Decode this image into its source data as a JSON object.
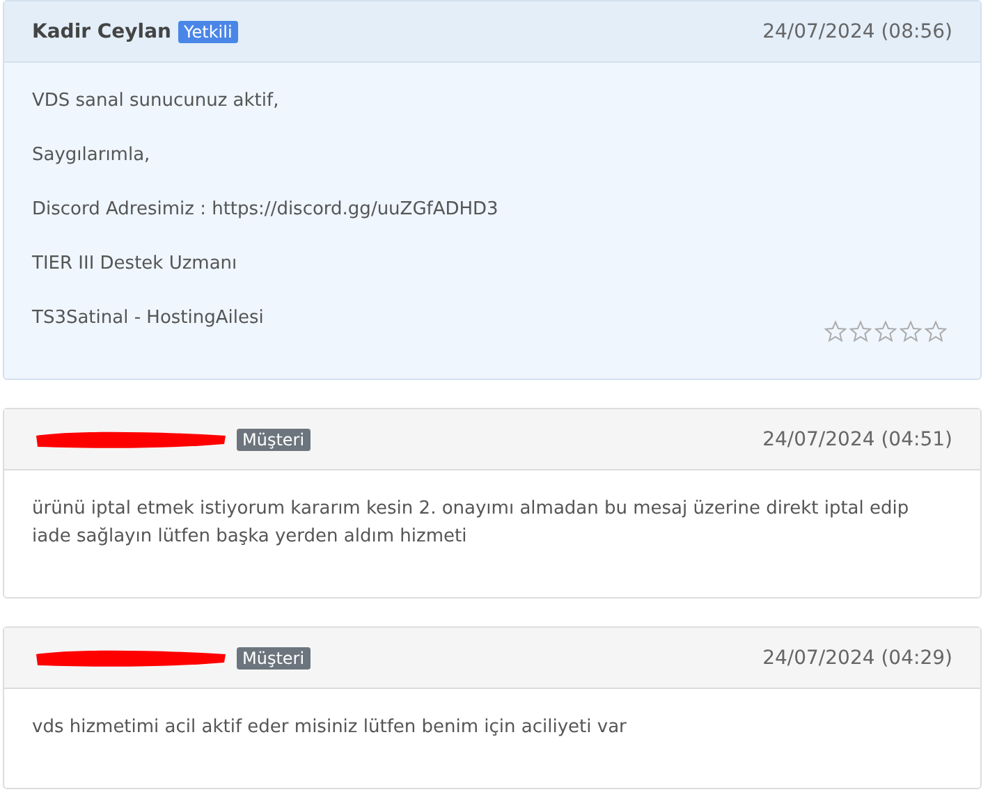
{
  "messages": [
    {
      "author": "Kadir Ceylan",
      "redacted": false,
      "badge": "Yetkili",
      "kind": "staff",
      "date": "24/07/2024 (08:56)",
      "paragraphs": [
        "VDS sanal sunucunuz aktif,",
        "Saygılarımla,",
        "Discord Adresimiz : https://discord.gg/uuZGfADHD3",
        "TIER III Destek Uzmanı",
        "TS3Satinal - HostingAilesi"
      ],
      "stars": 0
    },
    {
      "redacted": true,
      "badge": "Müşteri",
      "kind": "client",
      "date": "24/07/2024 (04:51)",
      "paragraphs": [
        "ürünü iptal etmek istiyorum kararım kesin 2. onayımı almadan bu mesaj üzerine direkt iptal edip iade sağlayın lütfen başka yerden aldım hizmeti"
      ]
    },
    {
      "redacted": true,
      "badge": "Müşteri",
      "kind": "client",
      "date": "24/07/2024 (04:29)",
      "paragraphs": [
        "vds hizmetimi acil aktif eder misiniz lütfen benim için aciliyeti var"
      ]
    }
  ]
}
